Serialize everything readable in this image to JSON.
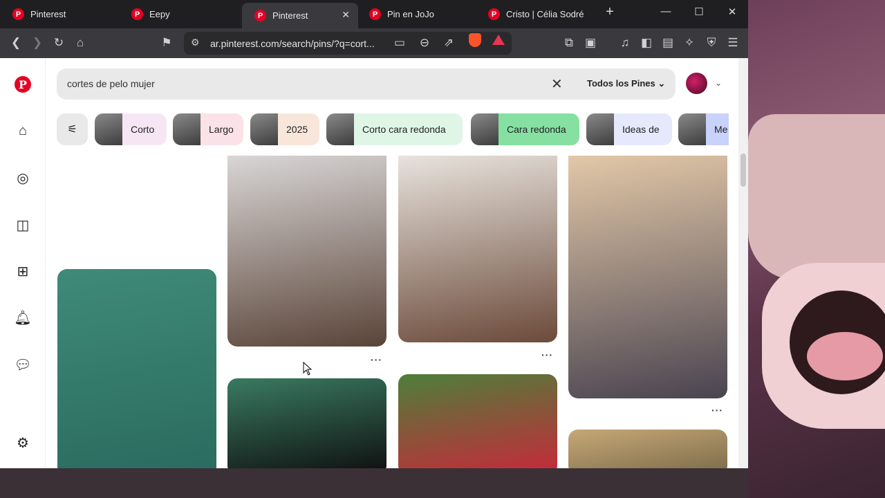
{
  "tabs": [
    {
      "title": "Pinterest",
      "active": false
    },
    {
      "title": "Eepy",
      "active": false
    },
    {
      "title": "Pinterest",
      "active": true
    },
    {
      "title": "Pin en JoJo",
      "active": false
    },
    {
      "title": "Cristo | Célia Sodré",
      "active": false
    }
  ],
  "tab_icon_letter": "P",
  "toolbar": {
    "url": "ar.pinterest.com/search/pins/?q=cort..."
  },
  "search": {
    "query": "cortes de pelo mujer",
    "scope": "Todos los Pines"
  },
  "chips": [
    {
      "label": "Corto",
      "color": "#f6e6f4"
    },
    {
      "label": "Largo",
      "color": "#fbe2e6"
    },
    {
      "label": "2025",
      "color": "#f9e6da"
    },
    {
      "label": "Corto cara redonda",
      "color": "#dff5e6"
    },
    {
      "label": "Cara redonda",
      "color": "#86e0a2"
    },
    {
      "label": "Ideas de",
      "color": "#e5e9fb"
    },
    {
      "label": "Me",
      "color": "#c9d2fb"
    }
  ],
  "pins": [
    {
      "name": "afro-green-background",
      "colors": [
        "#3f8a78",
        "#2a6b5e"
      ]
    },
    {
      "name": "curly-smiling",
      "colors": [
        "#d9d6d6",
        "#5a4438"
      ]
    },
    {
      "name": "afro-dark-bottom",
      "colors": [
        "#3a7a62",
        "#0e0e0e"
      ]
    },
    {
      "name": "glasses-afro",
      "colors": [
        "#e8e3dd",
        "#6b4a3a"
      ]
    },
    {
      "name": "red-mohawk",
      "colors": [
        "#4d7f3a",
        "#c8283a"
      ]
    },
    {
      "name": "ginger-afro-cut",
      "colors": [
        "#e3c8a8",
        "#4a4450"
      ]
    },
    {
      "name": "bottom-right-pin",
      "colors": [
        "#c6a876",
        "#7b6a4a"
      ]
    }
  ],
  "more_label": "···"
}
